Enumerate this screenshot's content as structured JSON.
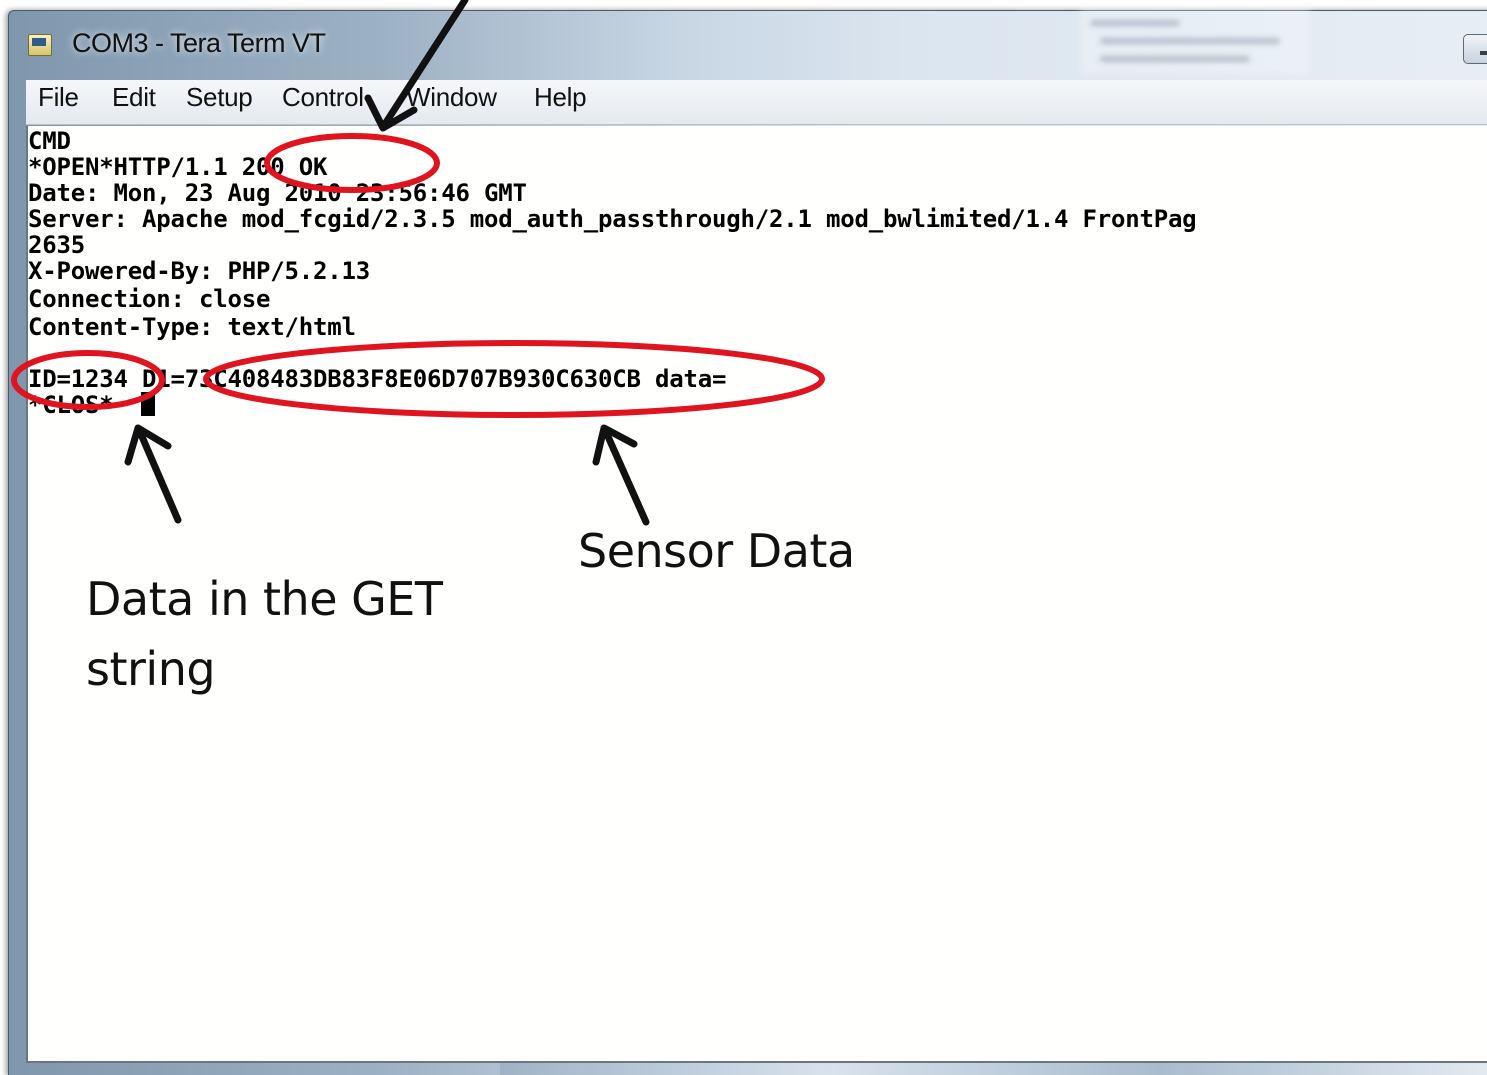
{
  "window": {
    "title": "COM3 - Tera Term VT"
  },
  "menu": {
    "items": [
      "File",
      "Edit",
      "Setup",
      "Control",
      "Window",
      "Help"
    ]
  },
  "terminal": {
    "lines": [
      "CMD",
      "*OPEN*HTTP/1.1 200 OK",
      "Date: Mon, 23 Aug 2010 23:56:46 GMT",
      "Server: Apache mod_fcgid/2.3.5 mod_auth_passthrough/2.1 mod_bwlimited/1.4 FrontPag",
      "2635",
      "X-Powered-By: PHP/5.2.13",
      "Connection: close",
      "Content-Type: text/html",
      "",
      "ID=1234 D1=73C408483DB83F8E06D707B930C630CB data=",
      "*CLOS*"
    ]
  },
  "annotations": {
    "sensor_label": "Sensor Data",
    "get_label_line1": "Data in the GET",
    "get_label_line2": "string"
  },
  "colors": {
    "highlight": "#e0141e",
    "arrow": "#111111"
  }
}
